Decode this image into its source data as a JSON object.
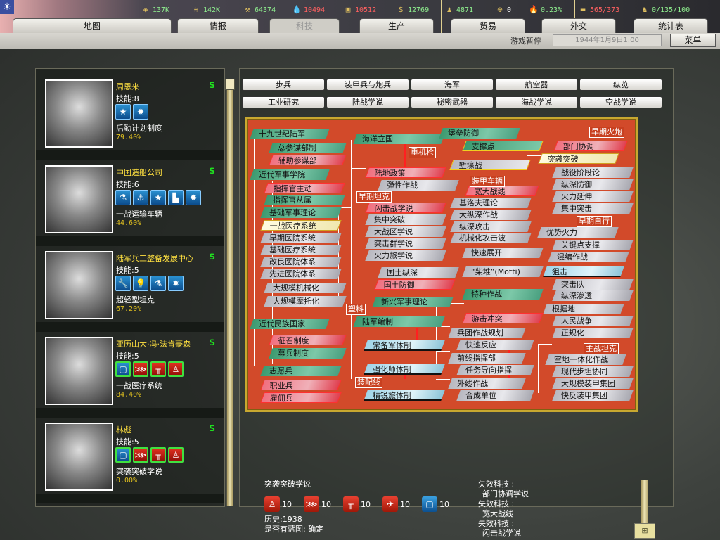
{
  "top": {
    "flag_icon": "taiwan-sun-flag",
    "resources": [
      {
        "icon": "energy-icon",
        "value": "137K",
        "color": "g"
      },
      {
        "icon": "metal-icon",
        "value": "142K",
        "color": "g"
      },
      {
        "icon": "rare-materials-icon",
        "value": "64374",
        "color": "g"
      },
      {
        "icon": "oil-icon",
        "value": "10494",
        "color": "r"
      },
      {
        "icon": "supplies-icon",
        "value": "10512",
        "color": "r"
      },
      {
        "icon": "money-icon",
        "value": "12769",
        "color": "g"
      },
      {
        "icon": "manpower-icon",
        "value": "4871",
        "color": "g"
      },
      {
        "icon": "nuclear-icon",
        "value": "0",
        "color": "w"
      },
      {
        "icon": "dissent-icon",
        "value": "0.23%",
        "color": "g"
      },
      {
        "icon": "transport-icon",
        "value": "565/373",
        "color": "r"
      },
      {
        "icon": "officers-icon",
        "value": "0/135/100",
        "color": "g"
      }
    ],
    "tabs": [
      "地图",
      "情报",
      "科技",
      "生产",
      "贸易",
      "外交",
      "统计表"
    ],
    "status": "游戏暂停",
    "date": "1944年1月9日1:00",
    "menu": "菜单"
  },
  "teams": [
    {
      "name": "周恩来",
      "skill": "技能:8",
      "icons": [
        "★",
        "✹"
      ],
      "project": "后勤计划制度",
      "progress": "79.40%"
    },
    {
      "name": "中国造船公司",
      "skill": "技能:6",
      "icons": [
        "⚗",
        "⚓",
        "★",
        "▙",
        "✹"
      ],
      "project": "一战运输车辆",
      "progress": "44.60%"
    },
    {
      "name": "陆军兵工整备发展中心",
      "skill": "技能:5",
      "icons": [
        "🔧",
        "💡",
        "⚗",
        "✹"
      ],
      "project": "超轻型坦克",
      "progress": "67.20%"
    },
    {
      "name": "亚历山大·冯·法肯豪森",
      "skill": "技能:5",
      "icons": [
        "▢",
        "⋙",
        "╥",
        "♙"
      ],
      "project": "一战医疗系统",
      "progress": "84.40%"
    },
    {
      "name": "林彪",
      "skill": "技能:5",
      "icons": [
        "▢",
        "⋙",
        "╥",
        "♙"
      ],
      "project": "突袭突破学说",
      "progress": "0.00%"
    }
  ],
  "categories": {
    "row1": [
      "步兵",
      "装甲兵与炮兵",
      "海军",
      "航空器",
      "纵览"
    ],
    "row2": [
      "工业研究",
      "陆战学说",
      "秘密武器",
      "海战学说",
      "空战学说"
    ]
  },
  "tree": {
    "nodes": [
      {
        "label": "十九世纪陆军",
        "state": "green"
      },
      {
        "label": "总参谋部制",
        "state": "green"
      },
      {
        "label": "辅助参谋部",
        "state": "red"
      },
      {
        "label": "近代军事学院",
        "state": "green"
      },
      {
        "label": "指挥官主动",
        "state": "red"
      },
      {
        "label": "指挥官从属",
        "state": "green"
      },
      {
        "label": "基础军事理论",
        "state": "green"
      },
      {
        "label": "一战医疗系统",
        "state": "yellow"
      },
      {
        "label": "早期医院系统",
        "state": "gray"
      },
      {
        "label": "基础医疗系统",
        "state": "gray"
      },
      {
        "label": "改良医院体系",
        "state": "gray"
      },
      {
        "label": "先进医院体系",
        "state": "gray"
      },
      {
        "label": "大规模机械化",
        "state": "gray"
      },
      {
        "label": "大规模摩托化",
        "state": "gray"
      },
      {
        "label": "近代民族国家",
        "state": "green"
      },
      {
        "label": "征召制度",
        "state": "red"
      },
      {
        "label": "募兵制度",
        "state": "green"
      },
      {
        "label": "志愿兵",
        "state": "green"
      },
      {
        "label": "职业兵",
        "state": "red"
      },
      {
        "label": "雇佣兵",
        "state": "red"
      },
      {
        "label": "海洋立国",
        "state": "green"
      },
      {
        "label": "陆地政策",
        "state": "red"
      },
      {
        "label": "弹性作战",
        "state": "gray"
      },
      {
        "label": "闪击战学说",
        "state": "red"
      },
      {
        "label": "集中突破",
        "state": "gray"
      },
      {
        "label": "大战区学说",
        "state": "gray"
      },
      {
        "label": "突击群学说",
        "state": "gray"
      },
      {
        "label": "火力旅学说",
        "state": "gray"
      },
      {
        "label": "国土纵深",
        "state": "gray"
      },
      {
        "label": "国土防御",
        "state": "red"
      },
      {
        "label": "新兴军事理论",
        "state": "green"
      },
      {
        "label": "陆军编制",
        "state": "green"
      },
      {
        "label": "常备军体制",
        "state": "blue"
      },
      {
        "label": "强化师体制",
        "state": "blue"
      },
      {
        "label": "精锐旅体制",
        "state": "blue"
      },
      {
        "label": "堡垒防御",
        "state": "green"
      },
      {
        "label": "支撑点",
        "state": "greeny"
      },
      {
        "label": "堑壕战",
        "state": "grayy"
      },
      {
        "label": "宽大战线",
        "state": "red"
      },
      {
        "label": "基洛夫理论",
        "state": "gray"
      },
      {
        "label": "大纵深作战",
        "state": "gray"
      },
      {
        "label": "纵深攻击",
        "state": "gray"
      },
      {
        "label": "机械化攻击波",
        "state": "gray"
      },
      {
        "label": "快速展开",
        "state": "gray"
      },
      {
        "label": "“柴堆”(Motti)",
        "state": "gray"
      },
      {
        "label": "特种作战",
        "state": "green"
      },
      {
        "label": "游击冲突",
        "state": "red"
      },
      {
        "label": "兵团作战规划",
        "state": "gray"
      },
      {
        "label": "快速反应",
        "state": "gray"
      },
      {
        "label": "前线指挥部",
        "state": "gray"
      },
      {
        "label": "任务导向指挥",
        "state": "gray"
      },
      {
        "label": "外线作战",
        "state": "gray"
      },
      {
        "label": "合成单位",
        "state": "gray"
      },
      {
        "label": "部门协调",
        "state": "red"
      },
      {
        "label": "突袭突破",
        "state": "yellow"
      },
      {
        "label": "战役阶段论",
        "state": "gray"
      },
      {
        "label": "纵深防御",
        "state": "gray"
      },
      {
        "label": "火力延伸",
        "state": "gray"
      },
      {
        "label": "集中突击",
        "state": "gray"
      },
      {
        "label": "优势火力",
        "state": "gray"
      },
      {
        "label": "关键点支撑",
        "state": "gray"
      },
      {
        "label": "混编作战",
        "state": "gray"
      },
      {
        "label": "狙击",
        "state": "blue"
      },
      {
        "label": "突击队",
        "state": "gray"
      },
      {
        "label": "纵深渗透",
        "state": "gray"
      },
      {
        "label": "根据地",
        "state": "gray"
      },
      {
        "label": "人民战争",
        "state": "gray"
      },
      {
        "label": "正规化",
        "state": "gray"
      },
      {
        "label": "空地一体化作战",
        "state": "gray"
      },
      {
        "label": "现代步坦协同",
        "state": "gray"
      },
      {
        "label": "大规模装甲集团",
        "state": "gray"
      },
      {
        "label": "快反装甲集团",
        "state": "gray"
      }
    ],
    "labels": [
      "重机枪",
      "早期坦克",
      "塑料",
      "装配线",
      "装甲车辆",
      "早期火炮",
      "早期自行",
      "主战坦克"
    ]
  },
  "detail": {
    "title": "突袭突破学说",
    "components": [
      {
        "icon": "infantry-icon",
        "glyph": "♙",
        "value": "10"
      },
      {
        "icon": "tactics-icon",
        "glyph": "⋙",
        "value": "10"
      },
      {
        "icon": "training-icon",
        "glyph": "╥",
        "value": "10"
      },
      {
        "icon": "aircraft-icon",
        "glyph": "✈",
        "value": "10"
      },
      {
        "icon": "theory-icon",
        "glyph": "▢",
        "value": "10"
      }
    ],
    "history": "历史:1938",
    "blueprint": "是否有蓝图:  确定",
    "lost": [
      {
        "label": "失效科技  :",
        "tech": "部门协调学说"
      },
      {
        "label": "失效科技  :",
        "tech": "宽大战线"
      },
      {
        "label": "失效科技  :",
        "tech": "闪击战学说"
      }
    ]
  }
}
